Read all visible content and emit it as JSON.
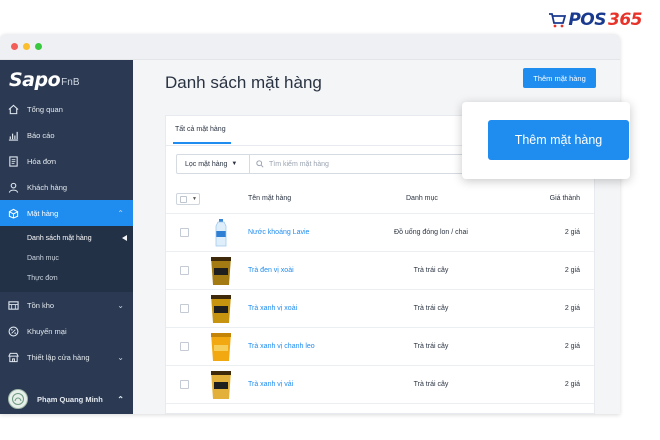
{
  "brand": {
    "pos": "POS",
    "num": "365"
  },
  "window": {
    "dot_colors": [
      "#f25f58",
      "#fbbe2e",
      "#38c93f"
    ]
  },
  "sidebar": {
    "logo": "Sapo",
    "logo_suffix": "FnB",
    "items": [
      {
        "label": "Tổng quan",
        "icon": "home-icon"
      },
      {
        "label": "Báo cáo",
        "icon": "chart-icon"
      },
      {
        "label": "Hóa đơn",
        "icon": "invoice-icon"
      },
      {
        "label": "Khách hàng",
        "icon": "user-icon"
      },
      {
        "label": "Mặt hàng",
        "icon": "box-icon",
        "active": true
      },
      {
        "label": "Tồn kho",
        "icon": "warehouse-icon"
      },
      {
        "label": "Khuyến mại",
        "icon": "promo-icon"
      },
      {
        "label": "Thiết lập cửa hàng",
        "icon": "store-settings-icon"
      }
    ],
    "subitems": [
      "Danh sách mặt hàng",
      "Danh mục",
      "Thực đơn"
    ],
    "user_name": "Phạm Quang Minh"
  },
  "main": {
    "title": "Danh sách mặt hàng",
    "add_button": "Thêm mặt hàng",
    "tab_all": "Tất cả mặt hàng",
    "filter_button": "Lọc mặt hàng",
    "search_placeholder": "Tìm kiếm mặt hàng",
    "columns": {
      "name": "Tên mặt hàng",
      "category": "Danh mục",
      "price": "Giá thành"
    },
    "rows": [
      {
        "name": "Nước khoáng Lavie",
        "category": "Đồ uống đóng lon / chai",
        "price": "2 giá",
        "thumb": "water-bottle"
      },
      {
        "name": "Trà đen vị xoài",
        "category": "Trà trái cây",
        "price": "2 giá",
        "thumb": "tea-cup"
      },
      {
        "name": "Trà xanh vị xoài",
        "category": "Trà trái cây",
        "price": "2 giá",
        "thumb": "tea-cup"
      },
      {
        "name": "Trà xanh vị chanh leo",
        "category": "Trà trái cây",
        "price": "2 giá",
        "thumb": "tea-cup"
      },
      {
        "name": "Trà xanh vị vải",
        "category": "Trà trái cây",
        "price": "2 giá",
        "thumb": "tea-cup"
      }
    ]
  },
  "callout": {
    "button": "Thêm mặt hàng"
  },
  "colors": {
    "accent": "#1f8cf0",
    "sidebar": "#2b3a52"
  }
}
